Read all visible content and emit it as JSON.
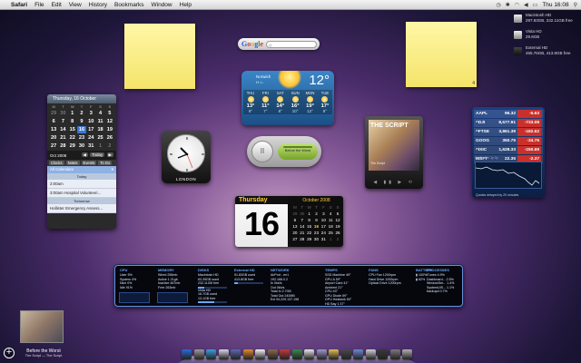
{
  "menubar": {
    "apple": "",
    "app_name": "Safari",
    "menus": [
      "File",
      "Edit",
      "View",
      "History",
      "Bookmarks",
      "Window",
      "Help"
    ],
    "clock": "Thu 16:08"
  },
  "drives": [
    {
      "name": "Macintosh HD",
      "detail": "297.83GB, 232.11GB free"
    },
    {
      "name": "Vista HD",
      "detail": "29.8GB"
    },
    {
      "name": "External HD",
      "detail": "465.76GB, 413.8GB free"
    }
  ],
  "stickies": {
    "right_count": "4"
  },
  "google": {
    "logo": "Google",
    "placeholder": "Q-"
  },
  "weather": {
    "city": "Norwich",
    "hilo": "H: L:",
    "current_temp": "12°",
    "days": [
      {
        "name": "THU",
        "hi": "13°",
        "lo": "9°"
      },
      {
        "name": "FRI",
        "hi": "11°",
        "lo": "7°"
      },
      {
        "name": "SAT",
        "hi": "14°",
        "lo": "8°"
      },
      {
        "name": "SUN",
        "hi": "16°",
        "lo": "10°"
      },
      {
        "name": "MON",
        "hi": "19°",
        "lo": "12°"
      },
      {
        "name": "TUE",
        "hi": "17°",
        "lo": "9°"
      }
    ]
  },
  "ical": {
    "header": "Thursday, 16 October",
    "weekdays": [
      "M",
      "T",
      "W",
      "T",
      "F",
      "S",
      "S"
    ],
    "days": [
      {
        "d": "29",
        "dim": true
      },
      {
        "d": "30",
        "dim": true
      },
      {
        "d": "1"
      },
      {
        "d": "2"
      },
      {
        "d": "3"
      },
      {
        "d": "4"
      },
      {
        "d": "5"
      },
      {
        "d": "6"
      },
      {
        "d": "7"
      },
      {
        "d": "8"
      },
      {
        "d": "9"
      },
      {
        "d": "10"
      },
      {
        "d": "11"
      },
      {
        "d": "12"
      },
      {
        "d": "13"
      },
      {
        "d": "14"
      },
      {
        "d": "15"
      },
      {
        "d": "16",
        "sel": true
      },
      {
        "d": "17"
      },
      {
        "d": "18"
      },
      {
        "d": "19"
      },
      {
        "d": "20"
      },
      {
        "d": "21"
      },
      {
        "d": "22"
      },
      {
        "d": "23"
      },
      {
        "d": "24"
      },
      {
        "d": "25"
      },
      {
        "d": "26"
      },
      {
        "d": "27"
      },
      {
        "d": "28"
      },
      {
        "d": "29"
      },
      {
        "d": "30"
      },
      {
        "d": "31"
      },
      {
        "d": "1",
        "dim": true
      },
      {
        "d": "2",
        "dim": true
      }
    ],
    "month_label": "Oct 2008",
    "today_button": "Today",
    "tabs": [
      "Clocks",
      "Notes",
      "Events",
      "To Do"
    ],
    "list_header": "All Calendars",
    "today_label": "Today",
    "events": [
      "2:00am",
      "3:00am  Hospital Volunteeri...",
      "Tomorrow",
      "Hollister  Emergency Assess..."
    ]
  },
  "clock": {
    "city": "LONDON"
  },
  "itunes": {
    "pause": "II",
    "track": "Before the Worst"
  },
  "album": {
    "title": "THE SCRIPT",
    "sub": "The Script",
    "controls": "◀ ▮▮ ▶ ⟲"
  },
  "stocks": {
    "rows": [
      {
        "sym": "AAPL",
        "price": "96.32",
        "change": "-5.63",
        "dir": "dn"
      },
      {
        "sym": "^DJI",
        "price": "8,577.91",
        "change": "-733.08",
        "dir": "dn"
      },
      {
        "sym": "^FTSE",
        "price": "3,861.39",
        "change": "-182.62",
        "dir": "dn"
      },
      {
        "sym": "GOOG",
        "price": "350.75",
        "change": "-34.76",
        "dir": "dn"
      },
      {
        "sym": "^IXIC",
        "price": "1,628.33",
        "change": "-150.69",
        "dir": "dn"
      },
      {
        "sym": "MSFT",
        "price": "22.35",
        "change": "-2.37",
        "dir": "dn"
      }
    ],
    "ranges": "1w 3m 6m 1y 2y",
    "footer": "Quotes delayed by 20 minutes"
  },
  "flipclock": {
    "day": "Thursday",
    "date": "16",
    "month_title": "October 2008",
    "weekdays": [
      "M",
      "T",
      "W",
      "T",
      "F",
      "S",
      "S"
    ],
    "days": [
      {
        "d": "29",
        "dim": true
      },
      {
        "d": "30",
        "dim": true
      },
      {
        "d": "1"
      },
      {
        "d": "2"
      },
      {
        "d": "3"
      },
      {
        "d": "4"
      },
      {
        "d": "5"
      },
      {
        "d": "6"
      },
      {
        "d": "7"
      },
      {
        "d": "8"
      },
      {
        "d": "9"
      },
      {
        "d": "10"
      },
      {
        "d": "11"
      },
      {
        "d": "12"
      },
      {
        "d": "13"
      },
      {
        "d": "14"
      },
      {
        "d": "15"
      },
      {
        "d": "16",
        "sel": true
      },
      {
        "d": "17"
      },
      {
        "d": "18"
      },
      {
        "d": "19"
      },
      {
        "d": "20"
      },
      {
        "d": "21"
      },
      {
        "d": "22"
      },
      {
        "d": "23"
      },
      {
        "d": "24"
      },
      {
        "d": "25"
      },
      {
        "d": "26"
      },
      {
        "d": "27"
      },
      {
        "d": "28"
      },
      {
        "d": "29"
      },
      {
        "d": "30"
      },
      {
        "d": "31"
      },
      {
        "d": "1",
        "dim": true
      },
      {
        "d": "2",
        "dim": true
      }
    ]
  },
  "istat": {
    "cpu": {
      "title": "CPU",
      "lines": [
        "User 5%",
        "System 4%",
        "Nice 0%",
        "Idle 91%"
      ]
    },
    "memory": {
      "title": "MEMORY",
      "lines": [
        "Wired 256mb",
        "Active 1.21gb",
        "Inactive 487mb",
        "Free 263mb"
      ]
    },
    "disks": {
      "title": "DISKS",
      "items": [
        {
          "name": "Macintosh HD",
          "lines": [
            "63.39GB used",
            "232.11GB free"
          ],
          "fill": 0.21
        },
        {
          "name": "Vista HD",
          "lines": [
            "16.7GB used",
            "13.1GB free"
          ],
          "fill": 0.56
        }
      ]
    },
    "external": {
      "title": "External HD",
      "lines": [
        "51.83GB used",
        "413.8GB free"
      ],
      "fill": 0.11
    },
    "network": {
      "title": "NETWORK",
      "lines": [
        "AirPort - en1",
        "192.168.0.2",
        "In 0kb/s",
        "Out 0kb/s",
        "Total In 2.7GB",
        "Total Out 240MB",
        "Ext 94.229.137.198"
      ]
    },
    "temps": {
      "title": "TEMPS",
      "lines": [
        "SSD Machine 49°",
        "GPU A 59°",
        "Airport Card 41°",
        "Ambient 21°",
        "CPU 43°",
        "GPU Diode 59°",
        "GPU Heatsink 50°",
        "HD Bay 1 37°"
      ]
    },
    "fans": {
      "title": "FANS",
      "lines": [
        "CPU Fan 1200rpm",
        "Hard Drive 1200rpm",
        "Optical Drive 1200rpm"
      ]
    },
    "battery": {
      "title": "BATTERY",
      "lines": [
        "100%",
        "62%"
      ]
    },
    "processes": {
      "title": "PROCESSES",
      "lines": [
        "iTunes 4.9%",
        "Dashboard... 2.5%",
        "WindowSer... 1.4%",
        "SystemUIS... 1.1%",
        "backupd 0.7%"
      ]
    }
  },
  "nowplaying": {
    "title": "Before the Worst",
    "artist": "The Script — The Script"
  },
  "dock_icons": [
    "#2a6cd8",
    "#9b9b9b",
    "#3aa0e0",
    "#d8d8e8",
    "#5a6ab0",
    "#e08a2a",
    "#f4f4f4",
    "#8a6a4a",
    "#c83a3a",
    "#3a8a4a",
    "#e8e8e8",
    "#9a9acb",
    "#e0c050",
    "#4a4a4a",
    "#6a8ad0",
    "#d0d0d0",
    "#3a3a3a",
    "#7a7a7a",
    "#b0b0b0"
  ]
}
